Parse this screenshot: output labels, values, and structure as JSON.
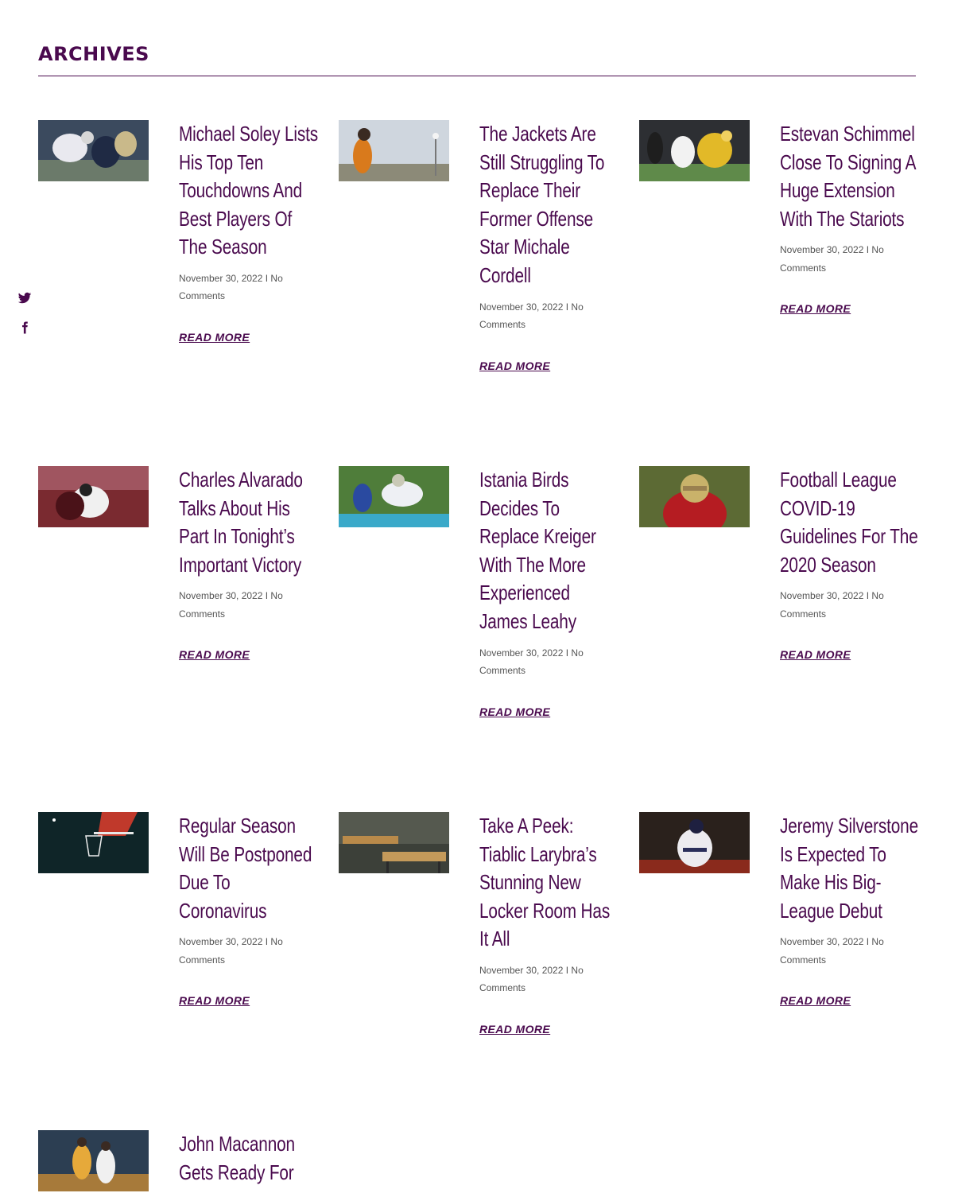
{
  "page": {
    "title": "ARCHIVES"
  },
  "social": {
    "twitter_icon": "twitter-icon",
    "facebook_icon": "facebook-icon"
  },
  "colors": {
    "accent": "#4a0a4e",
    "meta": "#555555",
    "background": "#ffffff"
  },
  "posts": [
    {
      "title": "Michael Soley Lists His Top Ten Touchdowns And Best Players Of The Season",
      "date": "November 30, 2022",
      "comments": "No Comments",
      "read_more": "READ MORE"
    },
    {
      "title": "The Jackets Are Still Struggling To Replace Their Former Offense Star Michale Cordell",
      "date": "November 30, 2022",
      "comments": "No Comments",
      "read_more": "READ MORE"
    },
    {
      "title": "Estevan Schimmel Close To Signing A Huge Extension With The Stariots",
      "date": "November 30, 2022",
      "comments": "No Comments",
      "read_more": "READ MORE"
    },
    {
      "title": "Charles Alvarado Talks About His Part In Tonight’s Important Victory",
      "date": "November 30, 2022",
      "comments": "No Comments",
      "read_more": "READ MORE"
    },
    {
      "title": "Istania Birds Decides To Replace Kreiger With The More Experienced James Leahy",
      "date": "November 30, 2022",
      "comments": "No Comments",
      "read_more": "READ MORE"
    },
    {
      "title": "Football League COVID-19 Guidelines For The 2020 Season",
      "date": "November 30, 2022",
      "comments": "No Comments",
      "read_more": "READ MORE"
    },
    {
      "title": "Regular Season Will Be Postponed Due To Coronavirus",
      "date": "November 30, 2022",
      "comments": "No Comments",
      "read_more": "READ MORE"
    },
    {
      "title": "Take A Peek: Tiablic Larybra’s Stunning New Locker Room Has It All",
      "date": "November 30, 2022",
      "comments": "No Comments",
      "read_more": "READ MORE"
    },
    {
      "title": "Jeremy Silverstone Is Expected To Make His Big-League Debut",
      "date": "November 30, 2022",
      "comments": "No Comments",
      "read_more": "READ MORE"
    },
    {
      "title": "John Macannon Gets Ready For",
      "date": "",
      "comments": "",
      "read_more": ""
    }
  ]
}
